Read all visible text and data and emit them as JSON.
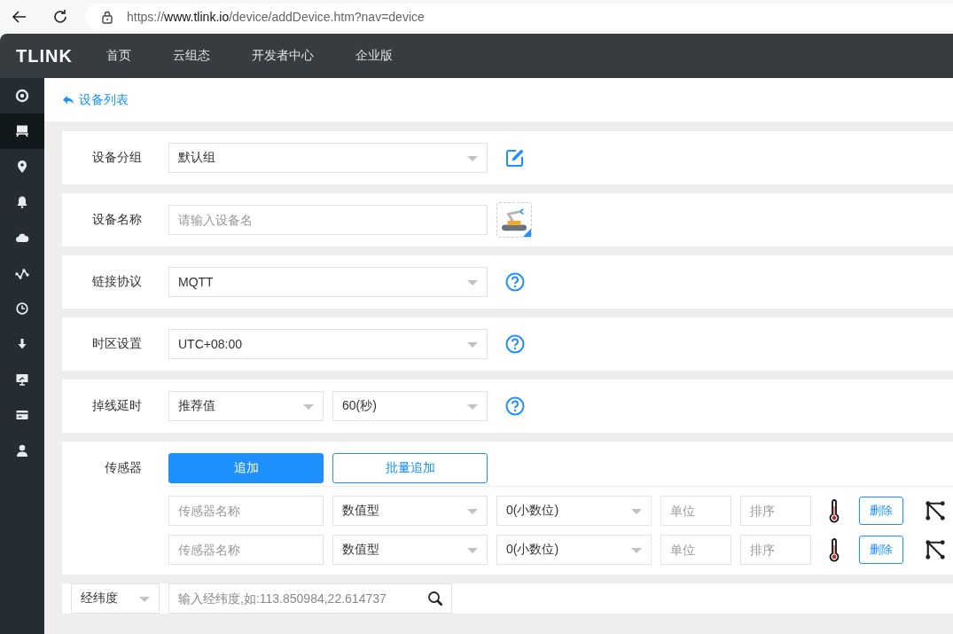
{
  "browser": {
    "url_scheme": "https://",
    "url_host": "www.tlink.io",
    "url_path": "/device/addDevice.htm?nav=device"
  },
  "header": {
    "logo": "TLINK",
    "nav": [
      "首页",
      "云组态",
      "开发者中心",
      "企业版"
    ]
  },
  "sidebar": {
    "items": [
      {
        "selected": false
      },
      {
        "selected": true
      },
      {
        "selected": false
      },
      {
        "selected": false
      },
      {
        "selected": false
      },
      {
        "selected": false
      },
      {
        "selected": false
      },
      {
        "selected": false
      },
      {
        "selected": false
      },
      {
        "selected": false
      },
      {
        "selected": false
      }
    ]
  },
  "back_link": "设备列表",
  "form_rows": [
    {
      "label": "设备分组",
      "fields": [
        {
          "kind": "select",
          "value": "默认组"
        }
      ],
      "action": {
        "kind": "edit"
      }
    },
    {
      "label": "设备名称",
      "fields": [
        {
          "kind": "input",
          "placeholder": "请输入设备名"
        }
      ],
      "action": {
        "kind": "image"
      }
    },
    {
      "label": "链接协议",
      "fields": [
        {
          "kind": "select",
          "value": "MQTT"
        }
      ],
      "action": {
        "kind": "help"
      }
    },
    {
      "label": "时区设置",
      "fields": [
        {
          "kind": "select",
          "value": "UTC+08:00"
        }
      ],
      "action": {
        "kind": "help"
      }
    },
    {
      "label": "掉线延时",
      "fields": [
        {
          "kind": "select",
          "value": "推荐值"
        },
        {
          "kind": "select",
          "value": "60(秒)"
        }
      ],
      "action": {
        "kind": "help"
      }
    }
  ],
  "sensors": {
    "label": "传感器",
    "buttons": [
      {
        "label": "追加",
        "kind": "primary"
      },
      {
        "label": "批量追加",
        "kind": "outline"
      }
    ],
    "rows": [
      {
        "name_placeholder": "传感器名称",
        "type": "数值型",
        "decimals": "0(小数位)",
        "unit_placeholder": "单位",
        "order_placeholder": "排序",
        "delete": "删除"
      },
      {
        "name_placeholder": "传感器名称",
        "type": "数值型",
        "decimals": "0(小数位)",
        "unit_placeholder": "单位",
        "order_placeholder": "排序",
        "delete": "删除"
      }
    ]
  },
  "location": {
    "mode": "经纬度",
    "placeholder": "输入经纬度,如:113.850984,22.614737"
  }
}
